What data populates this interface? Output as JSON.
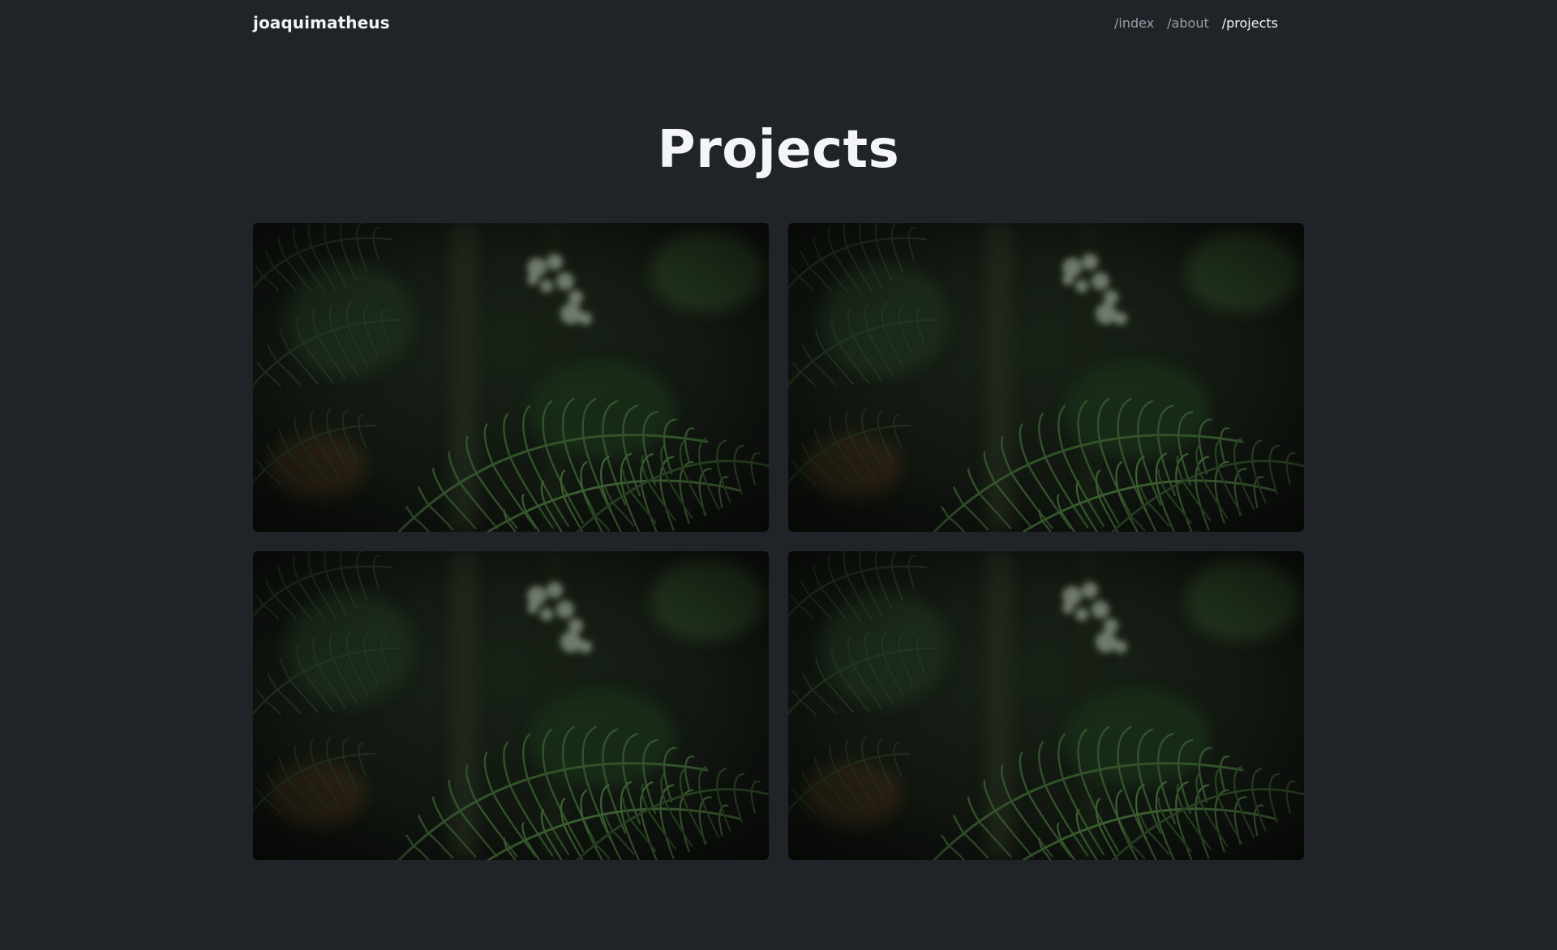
{
  "header": {
    "brand": "joaquimatheus",
    "nav": [
      {
        "label": "/index",
        "active": false
      },
      {
        "label": "/about",
        "active": false
      },
      {
        "label": "/projects",
        "active": true
      }
    ]
  },
  "page": {
    "title": "Projects"
  },
  "projects": [
    {
      "image": "jungle-fern-photo"
    },
    {
      "image": "jungle-fern-photo"
    },
    {
      "image": "jungle-fern-photo"
    },
    {
      "image": "jungle-fern-photo"
    }
  ],
  "colors": {
    "background": "#202328",
    "text_primary": "#f4f5f7",
    "text_muted": "#9aa0a8"
  }
}
